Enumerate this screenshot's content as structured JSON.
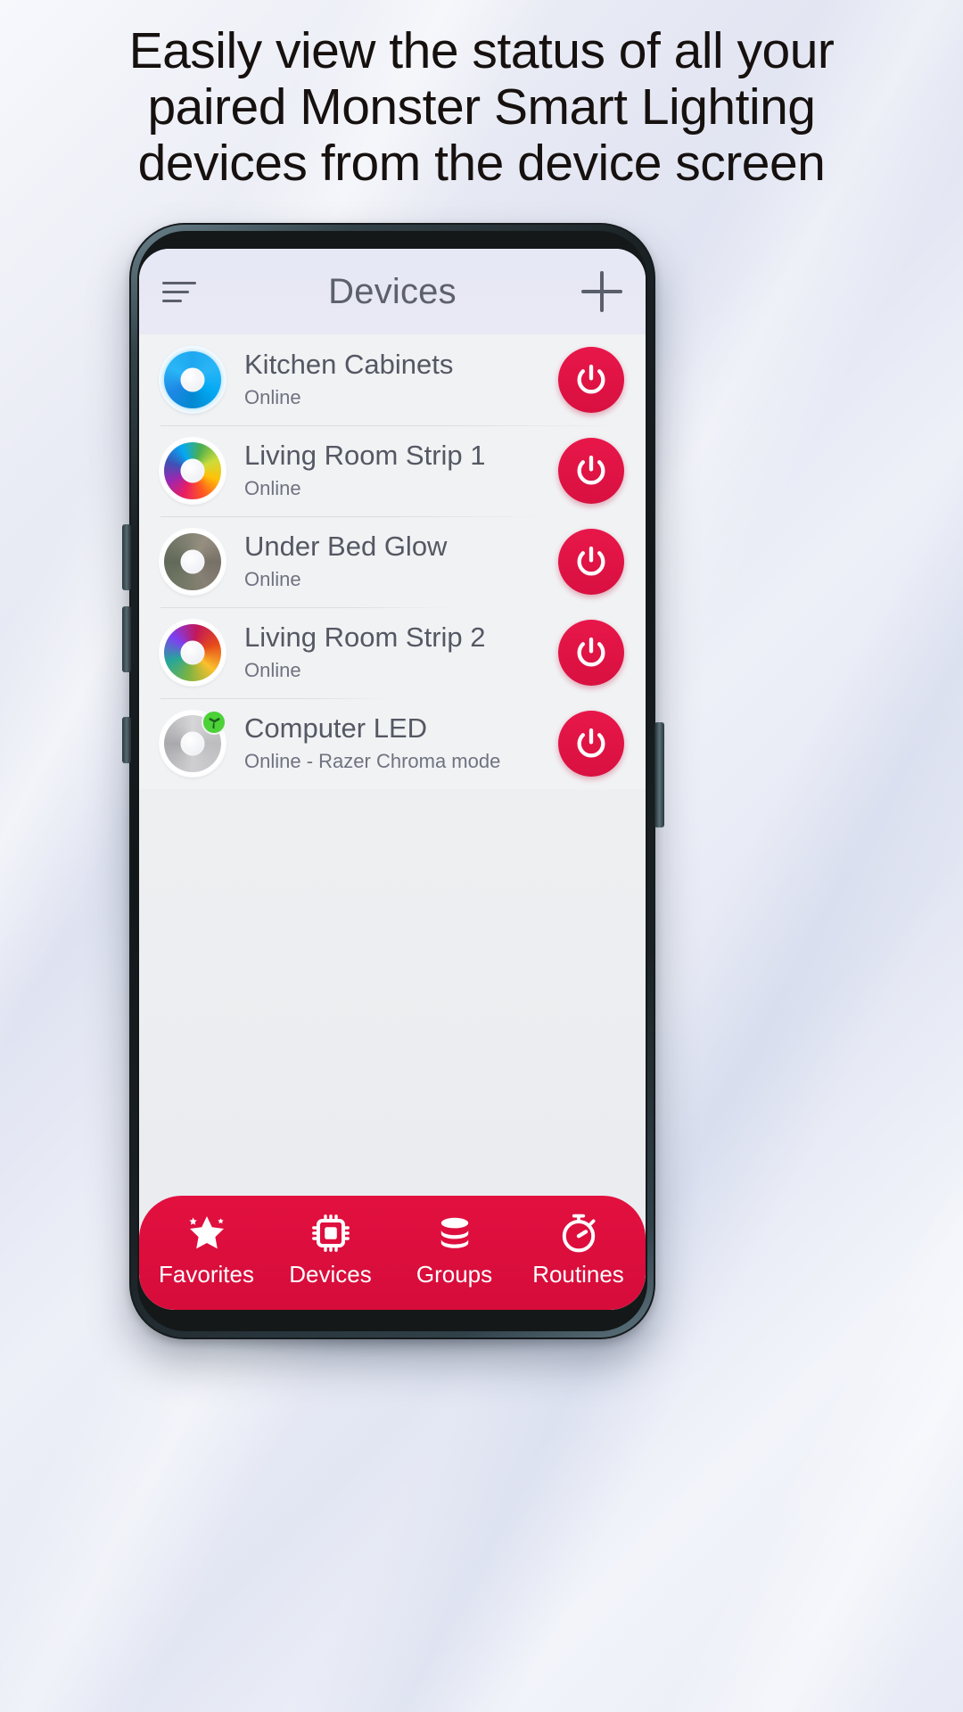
{
  "headline": {
    "line1": "Easily view the status of all your",
    "line2": "paired Monster Smart Lighting",
    "line3": "devices from the device screen"
  },
  "app": {
    "header": {
      "title": "Devices",
      "menu_icon": "hamburger-menu-icon",
      "add_icon": "plus-icon"
    },
    "devices": [
      {
        "name": "Kitchen Cabinets",
        "status": "Online",
        "icon": "color-wheel-blue",
        "power_icon": "power-icon"
      },
      {
        "name": "Living Room Strip 1",
        "status": "Online",
        "icon": "color-wheel-rainbow",
        "power_icon": "power-icon"
      },
      {
        "name": "Under Bed Glow",
        "status": "Online",
        "icon": "color-wheel-muted",
        "power_icon": "power-icon"
      },
      {
        "name": "Living Room Strip 2",
        "status": "Online",
        "icon": "color-wheel-rainbow2",
        "power_icon": "power-icon"
      },
      {
        "name": "Computer LED",
        "status": "Online - Razer Chroma mode",
        "icon": "color-wheel-grey",
        "badge": "razer-chroma-badge",
        "power_icon": "power-icon"
      }
    ],
    "bottom_nav": [
      {
        "label": "Favorites",
        "icon": "star-icon"
      },
      {
        "label": "Devices",
        "icon": "chip-icon"
      },
      {
        "label": "Groups",
        "icon": "stacked-disks-icon"
      },
      {
        "label": "Routines",
        "icon": "stopwatch-icon"
      }
    ]
  },
  "colors": {
    "brand_red": "#d81040",
    "screen_bg": "#eeeff1",
    "header_bg": "#e8e9f4",
    "text_primary": "#545863",
    "text_secondary": "#6f7380",
    "badge_green": "#4cd137"
  }
}
